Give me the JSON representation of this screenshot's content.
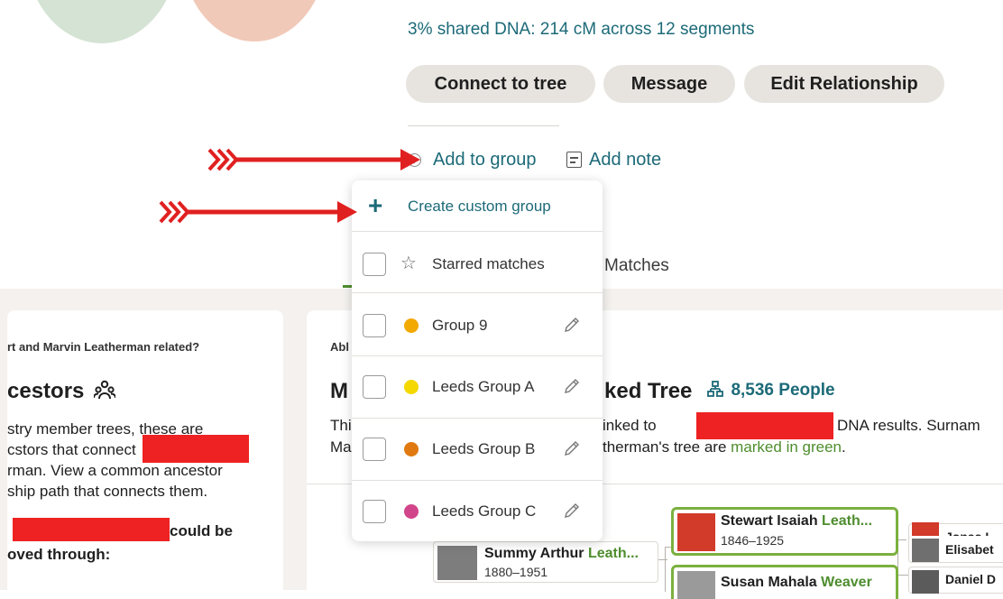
{
  "summary": {
    "shared_dna": "3% shared DNA: 214 cM across 12 segments"
  },
  "actions": {
    "connect": "Connect to tree",
    "message": "Message",
    "edit_relationship": "Edit Relationship"
  },
  "links": {
    "add_to_group": "Add to group",
    "add_note": "Add note"
  },
  "dropdown": {
    "create_label": "Create custom group",
    "starred_label": "Starred matches",
    "groups": [
      {
        "label": "Group 9",
        "color": "#f2a900"
      },
      {
        "label": "Leeds Group A",
        "color": "#f5d800"
      },
      {
        "label": "Leeds Group B",
        "color": "#e07a10"
      },
      {
        "label": "Leeds Group C",
        "color": "#d1458a"
      }
    ]
  },
  "tabs": {
    "matches_label": "Matches"
  },
  "left_card": {
    "question": "rt and Marvin Leatherman related?",
    "heading": "cestors",
    "body_lines": [
      "stry member trees, these are",
      "cstors that connect",
      "rman. View a common ancestor",
      "ship path that connects them."
    ],
    "bold_could_be": "could be",
    "bold_proved": "oved through:"
  },
  "right_card": {
    "label": "Abl",
    "heading_left": "M",
    "heading_right": "ked Tree",
    "people_count": "8,536 People",
    "line1_a": "Thi",
    "line1_b": "inked to",
    "line1_c": "DNA results. Surnam",
    "line2_a": "Ma",
    "line2_b": "therman's tree are ",
    "line2_green": "marked in green",
    "line2_end": "."
  },
  "tree": {
    "summy_first": "Summy Arthur ",
    "summy_last": "Leath...",
    "summy_dates": "1880–1951",
    "stewart_first": "Stewart Isaiah ",
    "stewart_last": "Leath...",
    "stewart_dates": "1846–1925",
    "susan_first": "Susan Mahala ",
    "susan_last": "Weaver",
    "jonas": "Jonas L",
    "elisabet": "Elisabet",
    "daniel": "Daniel D"
  },
  "colors": {
    "link_teal": "#1c6a78",
    "match_green": "#4e8d2e",
    "annotation_red": "#e02020",
    "page_grey": "#f4f1ee"
  }
}
